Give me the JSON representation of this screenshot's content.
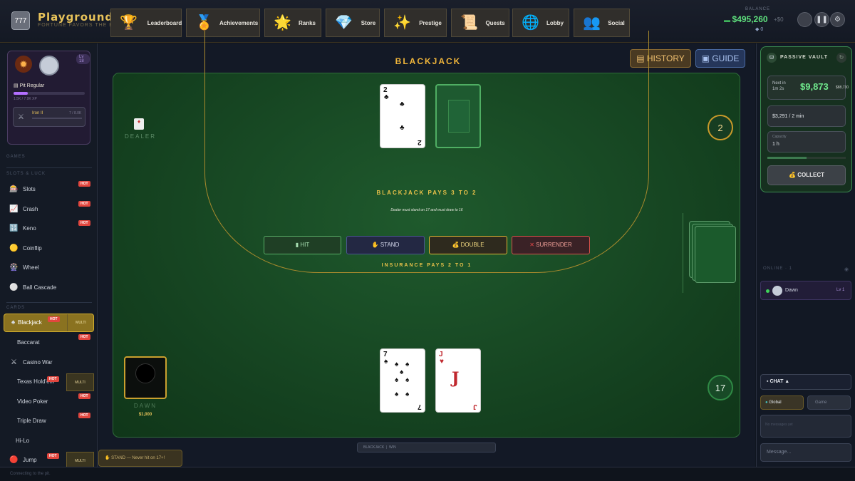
{
  "header": {
    "brand": "Playground",
    "tagline": "FORTUNE FAVORS THE BOLD",
    "nav": [
      {
        "label": "Leaderboard",
        "icon": "trophy-icon",
        "glyph": "🏆"
      },
      {
        "label": "Achievements",
        "icon": "medal-icon",
        "glyph": "🏅"
      },
      {
        "label": "Ranks",
        "icon": "star-icon",
        "glyph": "🌟"
      },
      {
        "label": "Store",
        "icon": "diamond-icon",
        "glyph": "💎"
      },
      {
        "label": "Prestige",
        "icon": "sparkles-icon",
        "glyph": "✨"
      },
      {
        "label": "Quests",
        "icon": "scroll-icon",
        "glyph": "📜"
      },
      {
        "label": "Lobby",
        "icon": "globe-icon",
        "glyph": "🌐"
      },
      {
        "label": "Social",
        "icon": "people-icon",
        "glyph": "👥"
      }
    ],
    "balance_label": "BALANCE",
    "balance": "$495,260",
    "balance_sub": "+$0",
    "gems": "0"
  },
  "profile": {
    "level": "Lv 18",
    "title": "Pit Regular",
    "xp_text": "1.5K / 7.9K XP",
    "xp_fraction": 0.2,
    "tier_name": "Iron II",
    "tier_value": "7 / 8.0K"
  },
  "sidebar": {
    "section_games": "GAMES",
    "section_slots": "SLOTS & LUCK",
    "section_cards": "CARDS",
    "games_luck": [
      {
        "label": "Slots",
        "icon": "slot-machine-icon",
        "glyph": "🎰",
        "hot": "HOT"
      },
      {
        "label": "Crash",
        "icon": "chart-icon",
        "glyph": "📈",
        "hot": "HOT"
      },
      {
        "label": "Keno",
        "icon": "numbers-icon",
        "glyph": "🔢",
        "hot": "HOT"
      },
      {
        "label": "Coinflip",
        "icon": "coin-icon",
        "glyph": "🟡",
        "hot": ""
      },
      {
        "label": "Wheel",
        "icon": "wheel-icon",
        "glyph": "🎡",
        "hot": ""
      },
      {
        "label": "Ball Cascade",
        "icon": "ball-icon",
        "glyph": "⚪",
        "hot": ""
      }
    ],
    "games_cards": [
      {
        "label": "Blackjack",
        "icon": "cards-icon",
        "glyph": "♠",
        "hot": "HOT",
        "multi": "MULTI"
      },
      {
        "label": "Baccarat",
        "icon": "baccarat-icon",
        "glyph": "",
        "hot": "HOT",
        "multi": ""
      },
      {
        "label": "Casino War",
        "icon": "swords-icon",
        "glyph": "⚔",
        "hot": "",
        "multi": ""
      },
      {
        "label": "Texas Hold'em",
        "icon": "holdem-icon",
        "glyph": "",
        "hot": "HOT",
        "multi": "MULTI"
      },
      {
        "label": "Video Poker",
        "icon": "video-poker-icon",
        "glyph": "",
        "hot": "HOT",
        "multi": ""
      },
      {
        "label": "Triple Draw",
        "icon": "triple-draw-icon",
        "glyph": "",
        "hot": "HOT",
        "multi": ""
      },
      {
        "label": "Hi-Lo",
        "icon": "hilo-icon",
        "glyph": "",
        "hot": "",
        "multi": ""
      },
      {
        "label": "Jump",
        "icon": "jump-icon",
        "glyph": "🔴",
        "hot": "HOT",
        "multi": "MULTI"
      }
    ],
    "status": "Connecting to the pit."
  },
  "main": {
    "title": "BLACKJACK",
    "history_label": "HISTORY",
    "guide_label": "GUIDE",
    "dealer_label": "DEALER",
    "dealer_score": "2",
    "dealer_card": {
      "rank": "2",
      "suit": "♣"
    },
    "pays_text": "BLACKJACK PAYS 3 TO 2",
    "rule_text": "Dealer must stand on 17 and must draw to 16",
    "insurance_text": "INSURANCE PAYS 2 TO 1",
    "actions": [
      {
        "label": "HIT",
        "glyph": "▮"
      },
      {
        "label": "STAND",
        "glyph": "✋"
      },
      {
        "label": "DOUBLE",
        "glyph": "💰"
      },
      {
        "label": "SURRENDER",
        "glyph": "✕"
      }
    ],
    "player_cards": [
      {
        "rank": "7",
        "suit": "♠"
      },
      {
        "rank": "J",
        "suit": "♥"
      }
    ],
    "player_score": "17",
    "player_name": "DAWN",
    "player_bet": "$1,000",
    "toast": "STAND — Never hit on 17+!",
    "bottom_info": [
      "BLACKJACK",
      "WIN",
      "",
      ""
    ]
  },
  "vault": {
    "title": "PASSIVE VAULT",
    "next_label": "Next in",
    "next_time": "1m 2s",
    "amount": "$9,873",
    "amount_sub": "$88,730",
    "rate": "$3,291 / 2 min",
    "capacity_label": "Capacity",
    "capacity_value": "1 h",
    "capacity_fraction": 0.5,
    "collect_label": "COLLECT"
  },
  "online": {
    "label": "ONLINE · 1",
    "user": "Dawn",
    "user_level": "Lv 1"
  },
  "chat": {
    "toggle_label": "CHAT ▲",
    "tab_global": "Global",
    "tab_game": "Game",
    "empty_text": "No messages yet",
    "placeholder": "Message..."
  }
}
